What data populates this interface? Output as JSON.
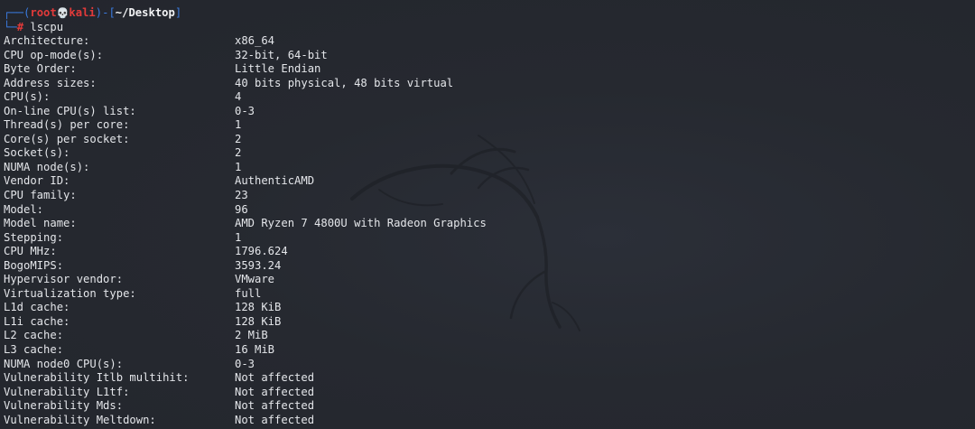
{
  "prompt": {
    "user": "root",
    "skull": "💀",
    "host": "kali",
    "cwd": "~/Desktop",
    "symbol": "#",
    "command": "lscpu"
  },
  "output": [
    {
      "key": "Architecture:",
      "value": "x86_64"
    },
    {
      "key": "CPU op-mode(s):",
      "value": "32-bit, 64-bit"
    },
    {
      "key": "Byte Order:",
      "value": "Little Endian"
    },
    {
      "key": "Address sizes:",
      "value": "40 bits physical, 48 bits virtual"
    },
    {
      "key": "CPU(s):",
      "value": "4"
    },
    {
      "key": "On-line CPU(s) list:",
      "value": "0-3"
    },
    {
      "key": "Thread(s) per core:",
      "value": "1"
    },
    {
      "key": "Core(s) per socket:",
      "value": "2"
    },
    {
      "key": "Socket(s):",
      "value": "2"
    },
    {
      "key": "NUMA node(s):",
      "value": "1"
    },
    {
      "key": "Vendor ID:",
      "value": "AuthenticAMD"
    },
    {
      "key": "CPU family:",
      "value": "23"
    },
    {
      "key": "Model:",
      "value": "96"
    },
    {
      "key": "Model name:",
      "value": "AMD Ryzen 7 4800U with Radeon Graphics"
    },
    {
      "key": "Stepping:",
      "value": "1"
    },
    {
      "key": "CPU MHz:",
      "value": "1796.624"
    },
    {
      "key": "BogoMIPS:",
      "value": "3593.24"
    },
    {
      "key": "Hypervisor vendor:",
      "value": "VMware"
    },
    {
      "key": "Virtualization type:",
      "value": "full"
    },
    {
      "key": "L1d cache:",
      "value": "128 KiB"
    },
    {
      "key": "L1i cache:",
      "value": "128 KiB"
    },
    {
      "key": "L2 cache:",
      "value": "2 MiB"
    },
    {
      "key": "L3 cache:",
      "value": "16 MiB"
    },
    {
      "key": "NUMA node0 CPU(s):",
      "value": "0-3"
    },
    {
      "key": "Vulnerability Itlb multihit:",
      "value": "Not affected"
    },
    {
      "key": "Vulnerability L1tf:",
      "value": "Not affected"
    },
    {
      "key": "Vulnerability Mds:",
      "value": "Not affected"
    },
    {
      "key": "Vulnerability Meltdown:",
      "value": "Not affected"
    }
  ],
  "colors": {
    "background": "#24272f",
    "text": "#e4e6ea",
    "prompt_frame": "#3a7be0",
    "prompt_user": "#e23a3a"
  }
}
